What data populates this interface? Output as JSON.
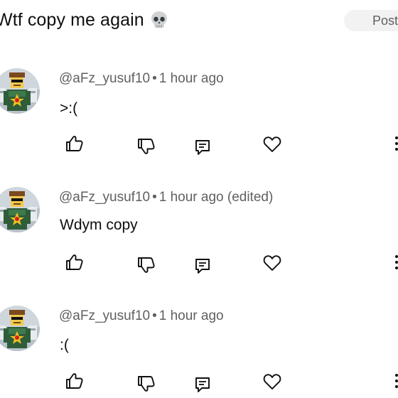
{
  "composer": {
    "draft_text": "Wtf copy me again",
    "emoji_icon": "skull-emoji",
    "post_label": "Post"
  },
  "comments": [
    {
      "author": "@aFz_yusuf10",
      "time": "1 hour ago",
      "edited": "",
      "text": ">:(",
      "icons": [
        "like-icon",
        "dislike-icon",
        "reply-icon",
        "heart-icon",
        "more-vertical-icon"
      ]
    },
    {
      "author": "@aFz_yusuf10",
      "time": "1 hour ago",
      "edited": "(edited)",
      "text": "Wdym copy",
      "icons": [
        "like-icon",
        "dislike-icon",
        "reply-icon",
        "heart-icon",
        "more-vertical-icon"
      ]
    },
    {
      "author": "@aFz_yusuf10",
      "time": "1 hour ago",
      "edited": "",
      "text": ":(",
      "icons": [
        "like-icon",
        "dislike-icon",
        "reply-icon",
        "heart-icon",
        "more-vertical-icon"
      ]
    }
  ],
  "colors": {
    "text": "#0f0f0f",
    "muted": "#606060",
    "button_bg": "#f2f2f2"
  }
}
